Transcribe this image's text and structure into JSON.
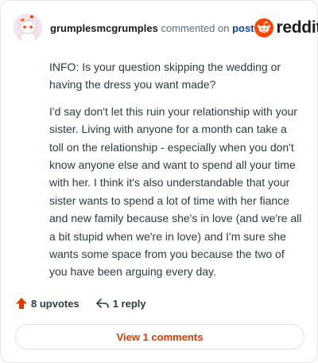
{
  "comment": {
    "author": "grumplesmcgrumples",
    "action_text": "commented on",
    "post_link": "post",
    "paragraphs": [
      "INFO: Is your question skipping the wedding or having the dress you want made?",
      "I'd say don't let this ruin your relationship with your sister. Living with anyone for a month can take a toll on the relationship - especially when you don't know anyone else and want to spend all your time with her. I think it's also understandable that your sister wants to spend a lot of time with her fiance and new family because she's in love (and we're all a bit stupid when we're in love) and I'm sure she wants some space from you because the two of you have been arguing every day."
    ],
    "upvotes": "8 upvotes",
    "replies": "1 reply"
  },
  "brand": {
    "wordmark": "reddit"
  },
  "view_comments_label": "View 1 comments",
  "colors": {
    "brand_orange": "#ff4500",
    "upvote_orange": "#d93a00",
    "link_blue": "#0a49a5"
  },
  "icons": {
    "avatar": "snoo-avatar",
    "logo": "reddit-snoo-icon",
    "upvote": "upvote-arrow-icon",
    "reply": "reply-arrow-icon"
  }
}
